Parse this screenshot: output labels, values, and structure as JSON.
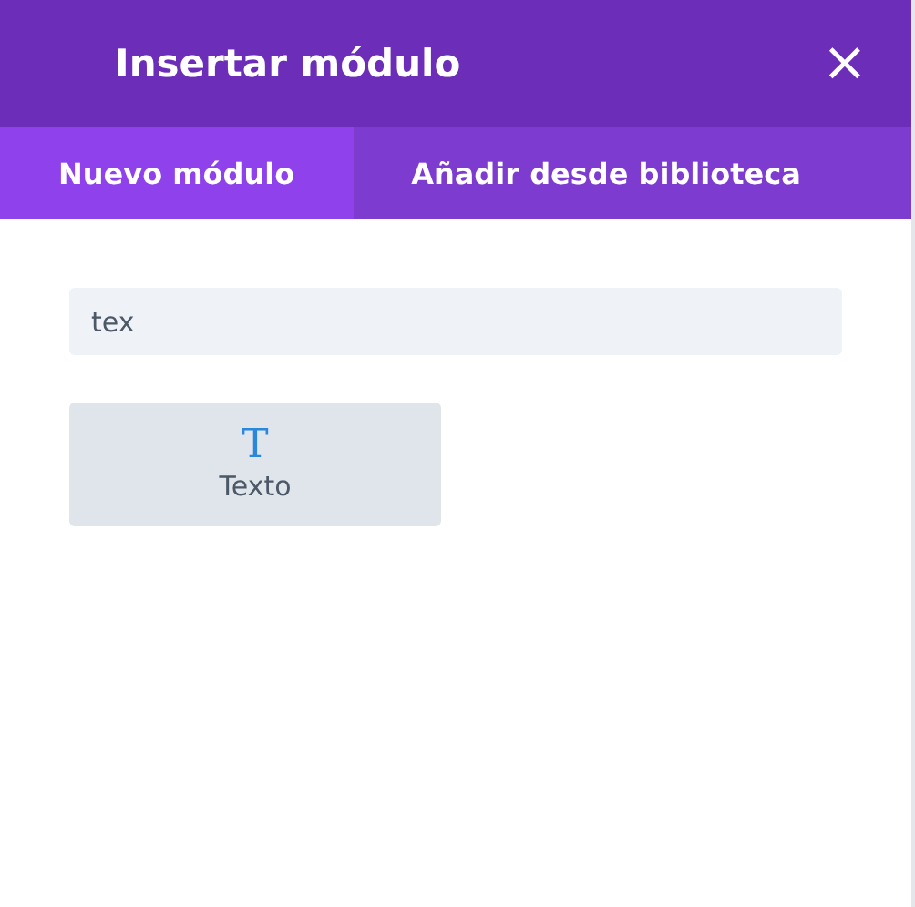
{
  "window": {
    "title": "Insertar módulo",
    "close": "×"
  },
  "tabs": [
    {
      "label": "Nuevo módulo",
      "selected": true
    },
    {
      "label": "Añadir desde biblioteca",
      "selected": false
    }
  ],
  "search": {
    "value": "tex"
  },
  "modules": [
    {
      "label": "Texto",
      "icon": "T"
    }
  ]
}
